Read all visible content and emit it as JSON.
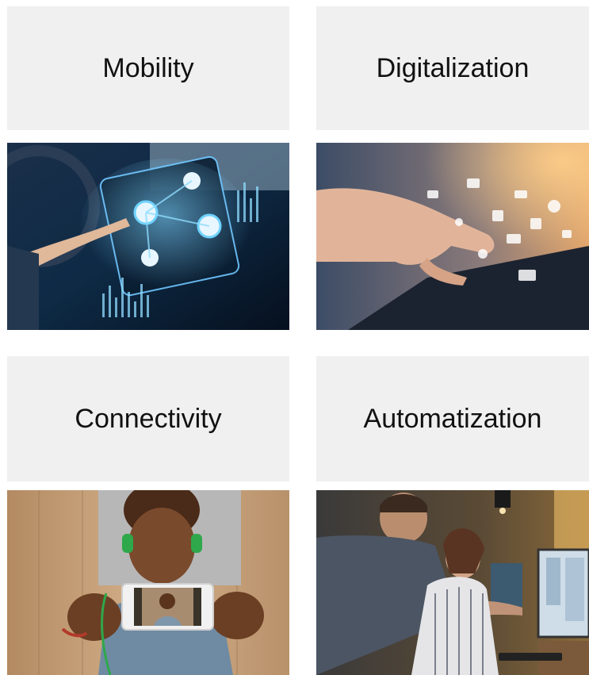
{
  "tiles": [
    {
      "label": "Mobility",
      "image": "car-dashboard-touchscreen-photo"
    },
    {
      "label": "Digitalization",
      "image": "hand-touching-tablet-icons-photo"
    },
    {
      "label": "Connectivity",
      "image": "man-holding-smartphone-photo"
    },
    {
      "label": "Automatization",
      "image": "people-at-computer-office-photo"
    }
  ]
}
